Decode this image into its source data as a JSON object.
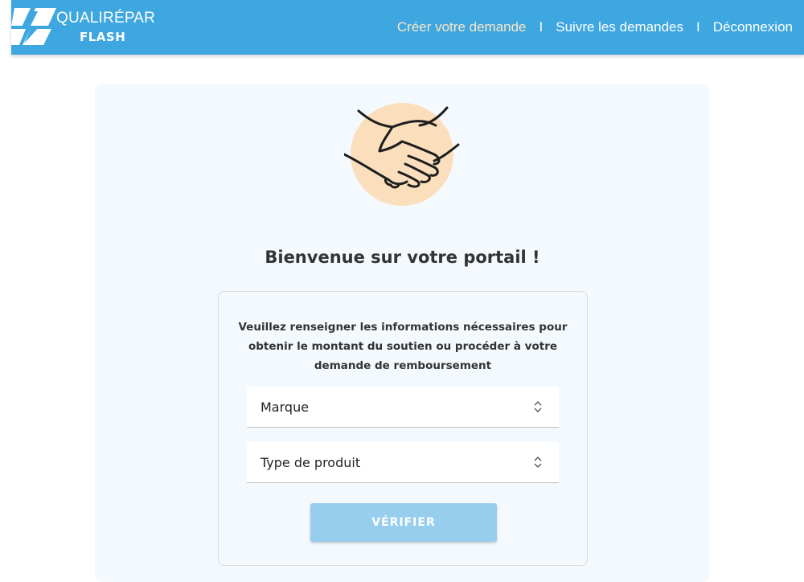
{
  "header": {
    "logo": {
      "name": "QualiRépar Flash",
      "line1": "QUALIRÉPAR",
      "line2": "FLASH"
    },
    "nav": [
      {
        "label": "Créer votre demande",
        "active": true
      },
      {
        "label": "Suivre les demandes",
        "active": false
      },
      {
        "label": "Déconnexion",
        "active": false
      }
    ],
    "separator": "I"
  },
  "main": {
    "hero_icon": "handshake-icon",
    "title": "Bienvenue sur votre portail !",
    "form": {
      "intro": "Veuillez renseigner les informations nécessaires pour obtenir le montant du soutien ou procéder à votre demande de remboursement",
      "brand_select": {
        "value": "Marque",
        "icon": "chevron-up-down-icon"
      },
      "product_type_select": {
        "value": "Type de produit",
        "icon": "chevron-up-down-icon"
      },
      "submit_label": "VÉRIFIER"
    }
  },
  "colors": {
    "header_bg": "#3ea7e0",
    "nav_active": "#fbe6c8",
    "card_bg": "#f4f9fd",
    "hero_circle": "#fbdfbd",
    "button_bg": "#97ceee"
  }
}
